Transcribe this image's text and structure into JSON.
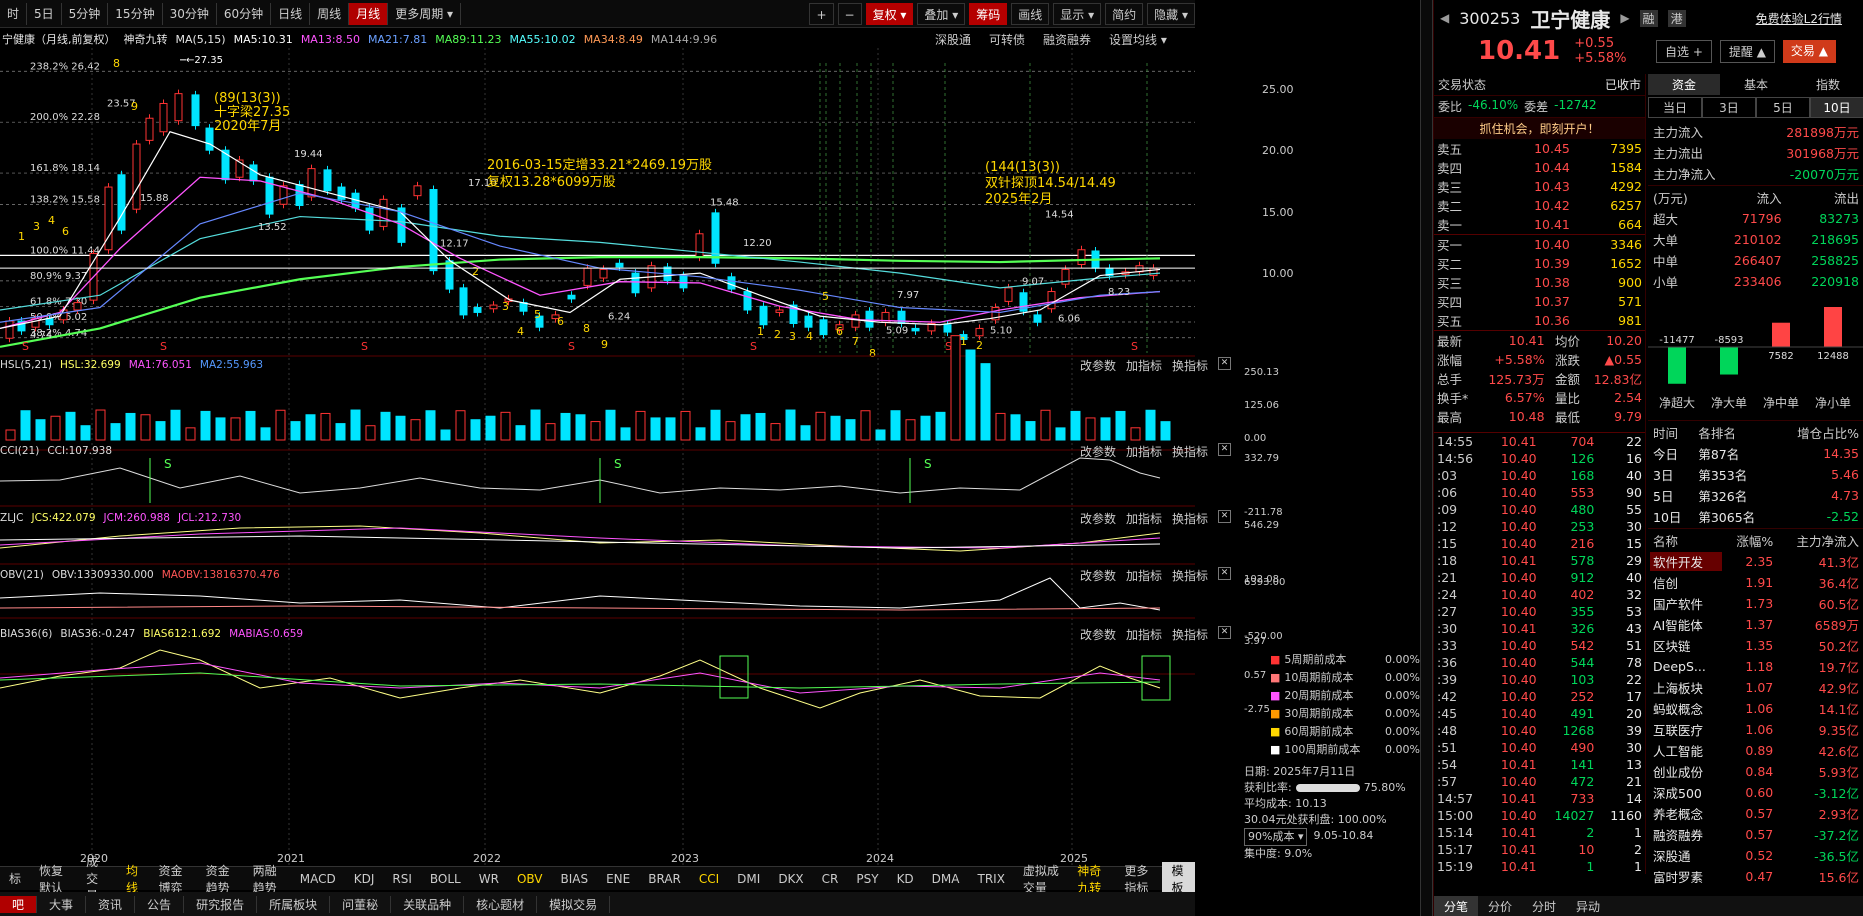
{
  "toolbar": {
    "items": [
      "时",
      "5日",
      "5分钟",
      "15分钟",
      "30分钟",
      "60分钟",
      "日线",
      "周线",
      "月线",
      "更多周期 ▾"
    ],
    "active": "月线",
    "right": [
      "+",
      "−",
      "复权 ▾",
      "叠加 ▾",
      "筹码",
      "画线",
      "显示 ▾",
      "简约",
      "隐藏 ▾"
    ]
  },
  "chart_header": {
    "name": "宁健康（月线,前复权）",
    "feature": "神奇九转",
    "ma_label": "MA(5,15)",
    "ma": [
      "MA5:10.31",
      "MA13:8.50",
      "MA21:7.81",
      "MA89:11.23",
      "MA55:10.02",
      "MA34:8.49",
      "MA144:9.96"
    ],
    "tools": [
      "深股通",
      "可转债",
      "融资融券",
      "设置均线 ▾"
    ]
  },
  "annotations": {
    "peak": "27.35",
    "fib": [
      "238.2% 26.42",
      "200.0% 22.28",
      "161.8% 18.14",
      "138.2% 15.58",
      "100.0% 11.44",
      "80.9% 9.37",
      "61.8% 7.30",
      "50.0% 6.02",
      "38.2% 4.74"
    ],
    "note1": [
      "(89(13(3))",
      "十字梁27.35",
      "2020年7月"
    ],
    "note2": [
      "2016-03-15定增33.21*2469.19万股",
      "复权13.28*6099万股"
    ],
    "note3": [
      "(144(13(3))",
      "双针探顶14.54/14.49",
      "2025年2月"
    ],
    "labels": [
      "23.57",
      "19.44",
      "17.10",
      "15.48",
      "15.88",
      "13.52",
      "12.17",
      "12.20",
      "7.97",
      "14.54",
      "9.07",
      "8.23",
      "6.06",
      "5.09",
      "5.10",
      "6.24",
      "4.74"
    ],
    "y_ticks": [
      "25.00",
      "20.00",
      "15.00",
      "10.00"
    ]
  },
  "indicators": [
    {
      "name": "HSL(5,21)",
      "vals": [
        "HSL:32.699",
        "MA1:76.051",
        "MA2:55.963"
      ],
      "ticks": [
        "250.13",
        "125.06",
        "0.00"
      ]
    },
    {
      "name": "CCI(21)",
      "vals": [
        "CCI:107.938"
      ],
      "ticks": [
        "332.79",
        "-211.78"
      ]
    },
    {
      "name": "ZLJC",
      "vals": [
        "JCS:422.079",
        "JCM:260.988",
        "JCL:212.730"
      ],
      "ticks": [
        "546.29",
        "102.08"
      ]
    },
    {
      "name": "OBV(21)",
      "vals": [
        "OBV:13309330.000",
        "MAOBV:13816370.476"
      ],
      "ticks": [
        "6393.00",
        "-520.00"
      ]
    },
    {
      "name": "BIAS36(6)",
      "vals": [
        "BIAS36:-0.247",
        "BIAS612:1.692",
        "MABIAS:0.659"
      ],
      "ticks": [
        "3.97",
        "0.57",
        "-2.75"
      ]
    }
  ],
  "panel_buttons": [
    "改参数",
    "加指标",
    "换指标"
  ],
  "x_axis": [
    "2020",
    "2021",
    "2022",
    "2023",
    "2024",
    "2025"
  ],
  "cost_legend": [
    {
      "label": "5周期前成本",
      "val": "0.00%"
    },
    {
      "label": "10周期前成本",
      "val": "0.00%"
    },
    {
      "label": "20周期前成本",
      "val": "0.00%"
    },
    {
      "label": "30周期前成本",
      "val": "0.00%"
    },
    {
      "label": "60周期前成本",
      "val": "0.00%"
    },
    {
      "label": "100周期前成本",
      "val": "0.00%"
    }
  ],
  "cost_info": {
    "date": "日期: 2025年7月11日",
    "ratio_label": "获利比率:",
    "ratio": "75.80%",
    "avg": "平均成本: 10.13",
    "profit": "30.04元处获利盘: 100.00%",
    "cost_sel": "90%成本 ▾",
    "range": "9.05-10.84",
    "conc": "集中度: 9.0%"
  },
  "bottom_tabs": [
    "标",
    "恢复默认",
    "成交量",
    "均线",
    "资金博弈",
    "资金趋势",
    "两融趋势",
    "MACD",
    "KDJ",
    "RSI",
    "BOLL",
    "WR",
    "OBV",
    "BIAS",
    "ENE",
    "BRAR",
    "CCI",
    "DMI",
    "DKX",
    "CR",
    "PSY",
    "KD",
    "DMA",
    "TRIX",
    "虚拟成交量",
    "神奇九转",
    "更多指标",
    "模板"
  ],
  "bottom_tabs2": [
    "吧",
    "大事",
    "资讯",
    "公告",
    "研究报告",
    "所属板块",
    "问董秘",
    "关联品种",
    "核心题材",
    "模拟交易"
  ],
  "stock": {
    "code": "300253",
    "name": "卫宁健康",
    "price": "10.41",
    "chg": "+0.55",
    "pct": "+5.58%",
    "tags": [
      "融",
      "港"
    ],
    "promo": "免费体验L2行情",
    "btns": [
      "自选 +",
      "提醒 ▲",
      "交易 ▲"
    ],
    "status_label": "交易状态",
    "status": "已收市",
    "wb": "委比",
    "wb_val": "-46.10%",
    "wc": "委差",
    "wc_val": "-12742",
    "ad": "抓住机会，即刻开户！"
  },
  "asks": [
    [
      "卖五",
      "10.45",
      "7395"
    ],
    [
      "卖四",
      "10.44",
      "1584"
    ],
    [
      "卖三",
      "10.43",
      "4292"
    ],
    [
      "卖二",
      "10.42",
      "6257"
    ],
    [
      "卖一",
      "10.41",
      "664"
    ]
  ],
  "bids": [
    [
      "买一",
      "10.40",
      "3346"
    ],
    [
      "买二",
      "10.39",
      "1652"
    ],
    [
      "买三",
      "10.38",
      "900"
    ],
    [
      "买四",
      "10.37",
      "571"
    ],
    [
      "买五",
      "10.36",
      "981"
    ]
  ],
  "quote": [
    [
      "最新",
      "10.41",
      "均价",
      "10.20"
    ],
    [
      "涨幅",
      "+5.58%",
      "涨跌",
      "▲0.55"
    ],
    [
      "总手",
      "125.73万",
      "金额",
      "12.83亿"
    ],
    [
      "换手*",
      "6.57%",
      "量比",
      "2.54"
    ],
    [
      "最高",
      "10.48",
      "最低",
      "9.79"
    ]
  ],
  "ticks": [
    [
      "14:55",
      "10.41",
      "704",
      "22"
    ],
    [
      "14:56",
      "10.40",
      "126",
      "16"
    ],
    [
      ":03",
      "10.40",
      "168",
      "40"
    ],
    [
      ":06",
      "10.40",
      "553",
      "90"
    ],
    [
      ":09",
      "10.40",
      "480",
      "55"
    ],
    [
      ":12",
      "10.40",
      "253",
      "30"
    ],
    [
      ":15",
      "10.40",
      "216",
      "15"
    ],
    [
      ":18",
      "10.41",
      "578",
      "29"
    ],
    [
      ":21",
      "10.40",
      "912",
      "40"
    ],
    [
      ":24",
      "10.40",
      "402",
      "32"
    ],
    [
      ":27",
      "10.40",
      "355",
      "53"
    ],
    [
      ":30",
      "10.41",
      "326",
      "43"
    ],
    [
      ":33",
      "10.40",
      "542",
      "51"
    ],
    [
      ":36",
      "10.40",
      "544",
      "78"
    ],
    [
      ":39",
      "10.40",
      "103",
      "22"
    ],
    [
      ":42",
      "10.40",
      "252",
      "17"
    ],
    [
      ":45",
      "10.40",
      "491",
      "20"
    ],
    [
      ":48",
      "10.40",
      "1268",
      "39"
    ],
    [
      ":51",
      "10.40",
      "490",
      "30"
    ],
    [
      ":54",
      "10.41",
      "141",
      "13"
    ],
    [
      ":57",
      "10.40",
      "472",
      "21"
    ],
    [
      "14:57",
      "10.41",
      "733",
      "14"
    ],
    [
      "15:00",
      "10.40",
      "14027",
      "1160"
    ],
    [
      "15:14",
      "10.41",
      "2",
      "1"
    ],
    [
      "15:17",
      "10.41",
      "10",
      "2"
    ],
    [
      "15:19",
      "10.41",
      "1",
      "1"
    ]
  ],
  "fund_tabs": [
    "资金",
    "基本",
    "指数"
  ],
  "day_tabs": [
    "当日",
    "3日",
    "5日",
    "10日"
  ],
  "main_flow": [
    [
      "主力流入",
      "281898万元"
    ],
    [
      "主力流出",
      "301968万元"
    ],
    [
      "主力净流入",
      "-20070万元"
    ]
  ],
  "flow_head": [
    "(万元)",
    "流入",
    "流出"
  ],
  "flow": [
    [
      "超大",
      "71796",
      "83273"
    ],
    [
      "大单",
      "210102",
      "218695"
    ],
    [
      "中单",
      "266407",
      "258825"
    ],
    [
      "小单",
      "233406",
      "220918"
    ]
  ],
  "net_chart": {
    "values": [
      -11477,
      -8593,
      7582,
      12488
    ],
    "labels": [
      "净超大",
      "净大单",
      "净中单",
      "净小单"
    ]
  },
  "rank_head": [
    "时间",
    "各排名",
    "增仓占比%"
  ],
  "rank": [
    [
      "今日",
      "第87名",
      "14.35"
    ],
    [
      "3日",
      "第353名",
      "5.46"
    ],
    [
      "5日",
      "第326名",
      "4.73"
    ],
    [
      "10日",
      "第3065名",
      "-2.52"
    ]
  ],
  "sector_head": [
    "名称",
    "涨幅%",
    "主力净流入"
  ],
  "sectors": [
    [
      "软件开发",
      "2.35",
      "41.3亿"
    ],
    [
      "信创",
      "1.91",
      "36.4亿"
    ],
    [
      "国产软件",
      "1.73",
      "60.5亿"
    ],
    [
      "AI智能体",
      "1.37",
      "6589万"
    ],
    [
      "区块链",
      "1.35",
      "50.2亿"
    ],
    [
      "DeepS...",
      "1.18",
      "19.7亿"
    ],
    [
      "上海板块",
      "1.07",
      "42.9亿"
    ],
    [
      "蚂蚁概念",
      "1.06",
      "14.1亿"
    ],
    [
      "互联医疗",
      "1.06",
      "9.35亿"
    ],
    [
      "人工智能",
      "0.89",
      "42.6亿"
    ],
    [
      "创业成份",
      "0.84",
      "5.93亿"
    ],
    [
      "深成500",
      "0.60",
      "-3.12亿"
    ],
    [
      "养老概念",
      "0.57",
      "2.93亿"
    ],
    [
      "融资融券",
      "0.57",
      "-37.2亿"
    ],
    [
      "深股通",
      "0.52",
      "-36.5亿"
    ],
    [
      "富时罗素",
      "0.47",
      "15.6亿"
    ]
  ],
  "right_bottom_tabs": [
    "分笔",
    "分价",
    "分时",
    "异动"
  ]
}
